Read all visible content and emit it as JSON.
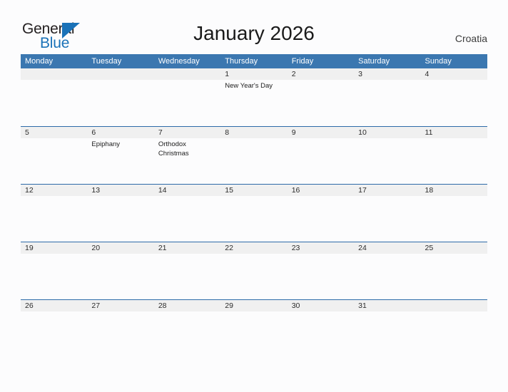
{
  "branding": {
    "logo_text_primary": "General",
    "logo_text_secondary": "Blue",
    "logo_flag_icon": "triangle-flag-icon",
    "accent_color": "#1a72b8"
  },
  "header": {
    "title": "January 2026",
    "country": "Croatia"
  },
  "theme": {
    "header_blue": "#3b77b0",
    "divider_blue": "#2d6ba8",
    "band_gray": "#f0f0f0",
    "page_background": "#fcfcfd",
    "text_color": "#2b2b2b"
  },
  "calendar": {
    "weekdays": [
      "Monday",
      "Tuesday",
      "Wednesday",
      "Thursday",
      "Friday",
      "Saturday",
      "Sunday"
    ],
    "weeks": [
      [
        {
          "day": "",
          "events": []
        },
        {
          "day": "",
          "events": []
        },
        {
          "day": "",
          "events": []
        },
        {
          "day": "1",
          "events": [
            "New Year's Day"
          ]
        },
        {
          "day": "2",
          "events": []
        },
        {
          "day": "3",
          "events": []
        },
        {
          "day": "4",
          "events": []
        }
      ],
      [
        {
          "day": "5",
          "events": []
        },
        {
          "day": "6",
          "events": [
            "Epiphany"
          ]
        },
        {
          "day": "7",
          "events": [
            "Orthodox Christmas"
          ]
        },
        {
          "day": "8",
          "events": []
        },
        {
          "day": "9",
          "events": []
        },
        {
          "day": "10",
          "events": []
        },
        {
          "day": "11",
          "events": []
        }
      ],
      [
        {
          "day": "12",
          "events": []
        },
        {
          "day": "13",
          "events": []
        },
        {
          "day": "14",
          "events": []
        },
        {
          "day": "15",
          "events": []
        },
        {
          "day": "16",
          "events": []
        },
        {
          "day": "17",
          "events": []
        },
        {
          "day": "18",
          "events": []
        }
      ],
      [
        {
          "day": "19",
          "events": []
        },
        {
          "day": "20",
          "events": []
        },
        {
          "day": "21",
          "events": []
        },
        {
          "day": "22",
          "events": []
        },
        {
          "day": "23",
          "events": []
        },
        {
          "day": "24",
          "events": []
        },
        {
          "day": "25",
          "events": []
        }
      ],
      [
        {
          "day": "26",
          "events": []
        },
        {
          "day": "27",
          "events": []
        },
        {
          "day": "28",
          "events": []
        },
        {
          "day": "29",
          "events": []
        },
        {
          "day": "30",
          "events": []
        },
        {
          "day": "31",
          "events": []
        },
        {
          "day": "",
          "events": []
        }
      ]
    ]
  }
}
